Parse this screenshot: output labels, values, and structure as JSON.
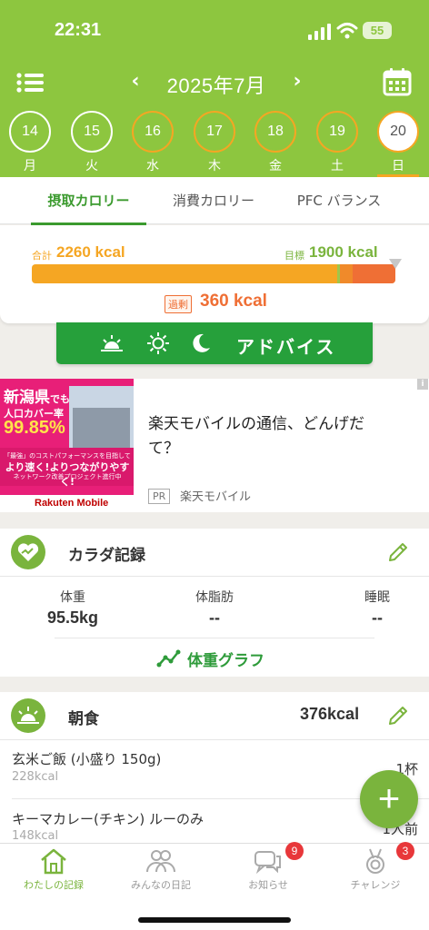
{
  "status_bar": {
    "time": "22:31",
    "battery": "55"
  },
  "header": {
    "month": "2025年7月",
    "days": [
      {
        "num": "14",
        "dow": "月",
        "state": "full"
      },
      {
        "num": "15",
        "dow": "火",
        "state": "full"
      },
      {
        "num": "16",
        "dow": "水",
        "state": "part"
      },
      {
        "num": "17",
        "dow": "木",
        "state": "part"
      },
      {
        "num": "18",
        "dow": "金",
        "state": "part"
      },
      {
        "num": "19",
        "dow": "土",
        "state": "part"
      },
      {
        "num": "20",
        "dow": "日",
        "state": "selected"
      }
    ]
  },
  "tabs": [
    "摂取カロリー",
    "消費カロリー",
    "PFC バランス"
  ],
  "calories": {
    "total_label": "合計",
    "total_value": "2260 kcal",
    "target_label": "目標",
    "target_value": "1900 kcal",
    "over_label": "過剰",
    "over_value": "360 kcal",
    "target_fraction": 0.84
  },
  "advice": {
    "label": "アドバイス"
  },
  "ad": {
    "image_headline": "新潟県",
    "image_headline_suffix": "でも",
    "image_line2": "人口カバー率",
    "image_rate": "99.85%",
    "image_small1": "「最強」のコストパフォーマンスを目指して",
    "image_slogan": "より速く!よりつながりやすく!",
    "image_small2": "ネットワーク改善プロジェクト進行中",
    "image_logo": "Rakuten Mobile",
    "title": "楽天モバイルの通信、どんげだて？",
    "pr_label": "PR",
    "advertiser": "楽天モバイル",
    "info": "i"
  },
  "body_record": {
    "title": "カラダ記録",
    "metrics": [
      {
        "label": "体重",
        "value": "95.5kg"
      },
      {
        "label": "体脂肪",
        "value": "--"
      },
      {
        "label": "睡眠",
        "value": "--"
      }
    ],
    "graph_label": "体重グラフ"
  },
  "breakfast": {
    "title": "朝食",
    "kcal": "376kcal",
    "items": [
      {
        "name": "玄米ご飯 (小盛り 150g)",
        "kcal": "228kcal",
        "qty": "1杯"
      },
      {
        "name": "キーマカレー(チキン) ルーのみ",
        "kcal": "148kcal",
        "qty": "1人前"
      }
    ]
  },
  "fab": {
    "label": "+"
  },
  "nav": [
    {
      "label": "わたしの記録",
      "badge": ""
    },
    {
      "label": "みんなの日記",
      "badge": ""
    },
    {
      "label": "お知らせ",
      "badge": "9"
    },
    {
      "label": "チャレンジ",
      "badge": "3"
    }
  ],
  "colors": {
    "brand_green": "#8dc63f",
    "accent_green": "#26a03b",
    "over_orange": "#ef6f35",
    "total_orange": "#f5a623"
  }
}
